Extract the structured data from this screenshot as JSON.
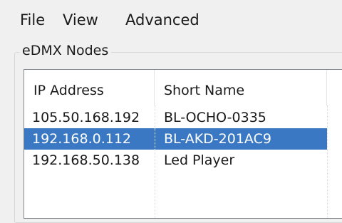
{
  "menu": {
    "file": "File",
    "view": "View",
    "advanced": "Advanced"
  },
  "group": {
    "label": "eDMX Nodes"
  },
  "table": {
    "columns": [
      "IP Address",
      "Short Name"
    ],
    "rows": [
      {
        "ip": "105.50.168.192",
        "name": "BL-OCHO-0335",
        "selected": false
      },
      {
        "ip": "192.168.0.112",
        "name": "BL-AKD-201AC9",
        "selected": true
      },
      {
        "ip": "192.168.50.138",
        "name": "Led Player",
        "selected": false
      }
    ]
  },
  "colors": {
    "selection": "#3a78c3",
    "window_bg": "#f0f0f0"
  }
}
